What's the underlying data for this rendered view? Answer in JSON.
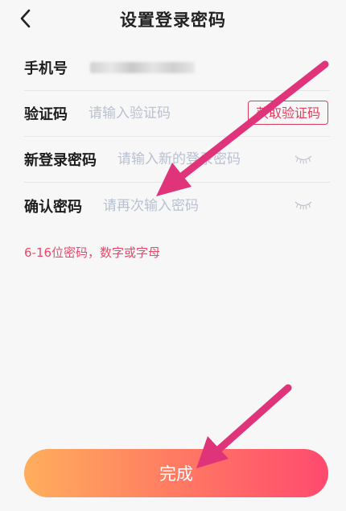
{
  "header": {
    "title": "设置登录密码",
    "back_icon": "chevron-left-icon"
  },
  "form": {
    "phone": {
      "label": "手机号",
      "value_masked": true
    },
    "code": {
      "label": "验证码",
      "placeholder": "请输入验证码",
      "button_label": "获取验证码"
    },
    "new_password": {
      "label": "新登录密码",
      "placeholder": "请输入新的登录密码",
      "toggle_icon": "eye-closed-icon"
    },
    "confirm_password": {
      "label": "确认密码",
      "placeholder": "请再次输入密码",
      "toggle_icon": "eye-closed-icon"
    }
  },
  "hint": "6-16位密码，数字或字母",
  "submit_label": "完成",
  "annotations": {
    "arrow_color": "#e0347a"
  },
  "colors": {
    "accent": "#e23c5c",
    "hint": "#e8496a",
    "button_gradient": [
      "#ffae5c",
      "#ff7a63",
      "#ff4a6e"
    ],
    "placeholder": "#b9c0d0"
  }
}
